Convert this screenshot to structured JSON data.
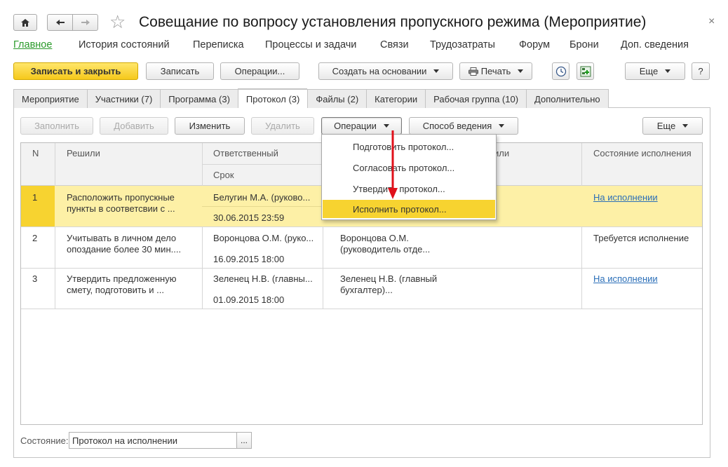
{
  "window": {
    "title": "Совещание по вопросу установления пропускного режима (Мероприятие)",
    "close_glyph": "×",
    "star_glyph": "☆"
  },
  "menu": {
    "items": [
      "Главное",
      "История состояний",
      "Переписка",
      "Процессы и задачи",
      "Связи",
      "Трудозатраты",
      "Форум",
      "Брони",
      "Доп. сведения"
    ]
  },
  "toolbar": {
    "save_close": "Записать и закрыть",
    "save": "Записать",
    "operations": "Операции...",
    "create_based": "Создать на основании",
    "print": "Печать",
    "more": "Еще",
    "help": "?"
  },
  "tabs": [
    "Мероприятие",
    "Участники (7)",
    "Программа (3)",
    "Протокол (3)",
    "Файлы (2)",
    "Категории",
    "Рабочая группа (10)",
    "Дополнительно"
  ],
  "protocol_toolbar": {
    "fill": "Заполнить",
    "add": "Добавить",
    "edit": "Изменить",
    "delete": "Удалить",
    "operations": "Операции",
    "method": "Способ ведения",
    "more": "Еще"
  },
  "table": {
    "columns": {
      "n": "N",
      "decided": "Решили",
      "responsible": "Ответственный",
      "deadline": "Срок",
      "controller_partial": "или",
      "status": "Состояние исполнения"
    },
    "rows": [
      {
        "n": "1",
        "decided": "Расположить пропускные пункты в соответсвии с ...",
        "responsible": "Белугин М.А. (руково...",
        "deadline": "30.06.2015 23:59",
        "controller": "",
        "status": "На исполнении",
        "status_is_link": true
      },
      {
        "n": "2",
        "decided": "Учитывать в личном дело опоздание более 30 мин....",
        "responsible": "Воронцова О.М. (руко...",
        "deadline": "16.09.2015 18:00",
        "controller": "Воронцова О.М. (руководитель отде...",
        "status": "Требуется исполнение",
        "status_is_link": false
      },
      {
        "n": "3",
        "decided": "Утвердить предложенную смету, подготовить и ...",
        "responsible": "Зеленец Н.В. (главны...",
        "deadline": "01.09.2015 18:00",
        "controller": "Зеленец Н.В. (главный бухгалтер)...",
        "status": "На исполнении",
        "status_is_link": true
      }
    ]
  },
  "operations_menu": {
    "items": [
      "Подготовить протокол...",
      "Согласовать протокол...",
      "Утвердить протокол...",
      "Исполнить протокол..."
    ],
    "selected": "Исполнить протокол...",
    "arrow_color": "#e0101a"
  },
  "state": {
    "label": "Состояние:",
    "value": "Протокол на исполнении",
    "button": "..."
  },
  "colors": {
    "accent_green": "#2a9a2a",
    "primary_button": "#f6c91b",
    "selected_row": "#fdf0a6",
    "menu_highlight": "#f7d330",
    "link": "#2b6fb8"
  }
}
